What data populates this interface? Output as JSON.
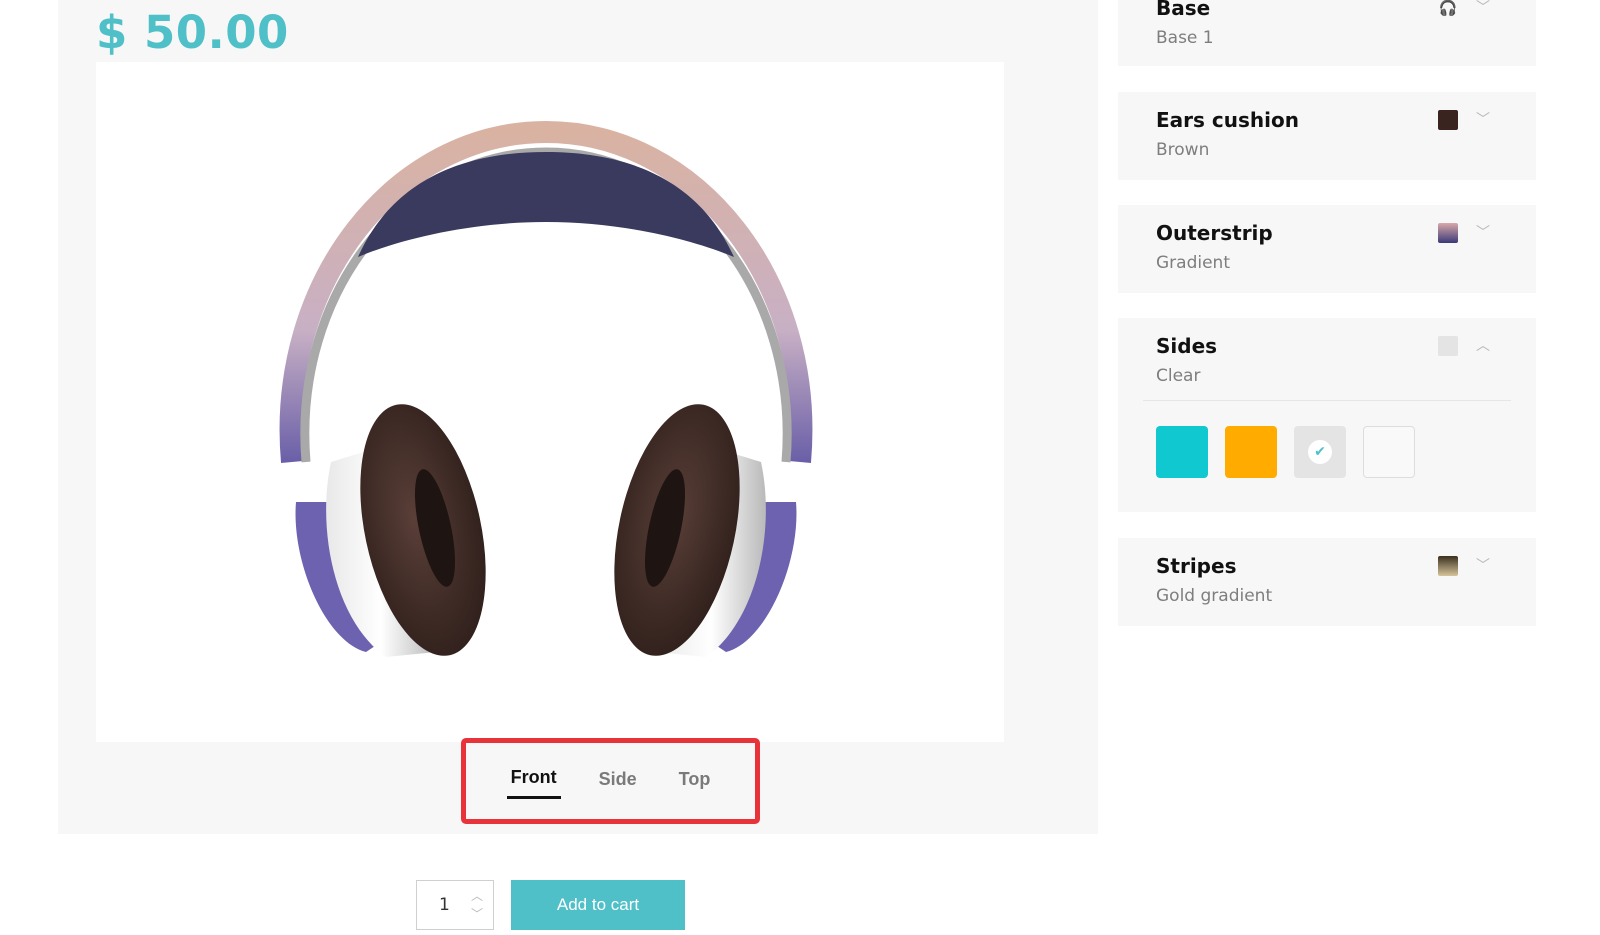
{
  "product": {
    "price": "$ 50.00",
    "image_alt": "headphones"
  },
  "views": {
    "tabs": [
      {
        "label": "Front",
        "active": true
      },
      {
        "label": "Side",
        "active": false
      },
      {
        "label": "Top",
        "active": false
      }
    ]
  },
  "cart": {
    "quantity": "1",
    "add_label": "Add to cart"
  },
  "options": [
    {
      "title": "Base",
      "value": "Base 1",
      "icon": "headphones-icon",
      "expanded": false
    },
    {
      "title": "Ears cushion",
      "value": "Brown",
      "swatch": "#3a2420",
      "expanded": false
    },
    {
      "title": "Outerstrip",
      "value": "Gradient",
      "swatch_gradient": [
        "#d9a8a8",
        "#3a3a7a"
      ],
      "expanded": false
    },
    {
      "title": "Sides",
      "value": "Clear",
      "swatch": "#e4e4e4",
      "expanded": true,
      "choices": [
        {
          "name": "cyan",
          "color": "#10c8cf",
          "selected": false
        },
        {
          "name": "orange",
          "color": "#ffab00",
          "selected": false
        },
        {
          "name": "clear",
          "color": "#e4e4e4",
          "selected": true
        },
        {
          "name": "white",
          "color": "#f9f9f9",
          "selected": false
        }
      ]
    },
    {
      "title": "Stripes",
      "value": "Gold gradient",
      "swatch_gradient": [
        "#3b3020",
        "#d6c49a"
      ],
      "expanded": false
    }
  ],
  "colors": {
    "accent": "#4fbfc8",
    "highlight_border": "#e8333b"
  }
}
